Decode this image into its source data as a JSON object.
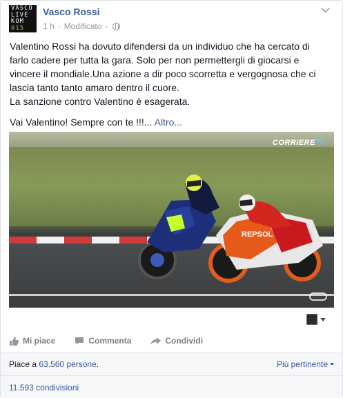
{
  "post": {
    "author": "Vasco Rossi",
    "avatar_text": [
      "VASCO",
      "LIVE",
      "KOM",
      "015"
    ],
    "time": "1 h",
    "edited_label": "Modificato",
    "text_lines": [
      "Valentino Rossi ha dovuto difendersi da un individuo che ha cercato di",
      "farlo cadere per tutta la gara. Solo per non permettergli di giocarsi e",
      "vincere il mondiale.Una azione a dir poco scorretta e vergognosa che ci",
      "lascia tanto tanto amaro dentro il cuore.",
      "La sanzione contro Valentino è esagerata."
    ],
    "closing_line": "Vai Valentino! Sempre con te !!!...",
    "more_link": "Altro..."
  },
  "video": {
    "watermark_main": "CORRIERE",
    "watermark_tv": "TV",
    "rider_number_text": "REPSOL"
  },
  "actions": {
    "like": "Mi piace",
    "comment": "Commenta",
    "share": "Condividi"
  },
  "footer": {
    "likes_prefix": "Piace a ",
    "likes_count": "63.560 persone",
    "likes_suffix": ".",
    "sort_label": "Più pertinente",
    "shares": "11.593 condivisioni"
  },
  "colors": {
    "link": "#3b5998",
    "muted": "#9197a3",
    "action": "#7f7f7f"
  },
  "icons": {
    "options": "chevron-down-icon",
    "privacy": "globe-icon",
    "like": "thumbs-up-icon",
    "comment": "speech-bubble-icon",
    "share": "share-arrow-icon"
  }
}
